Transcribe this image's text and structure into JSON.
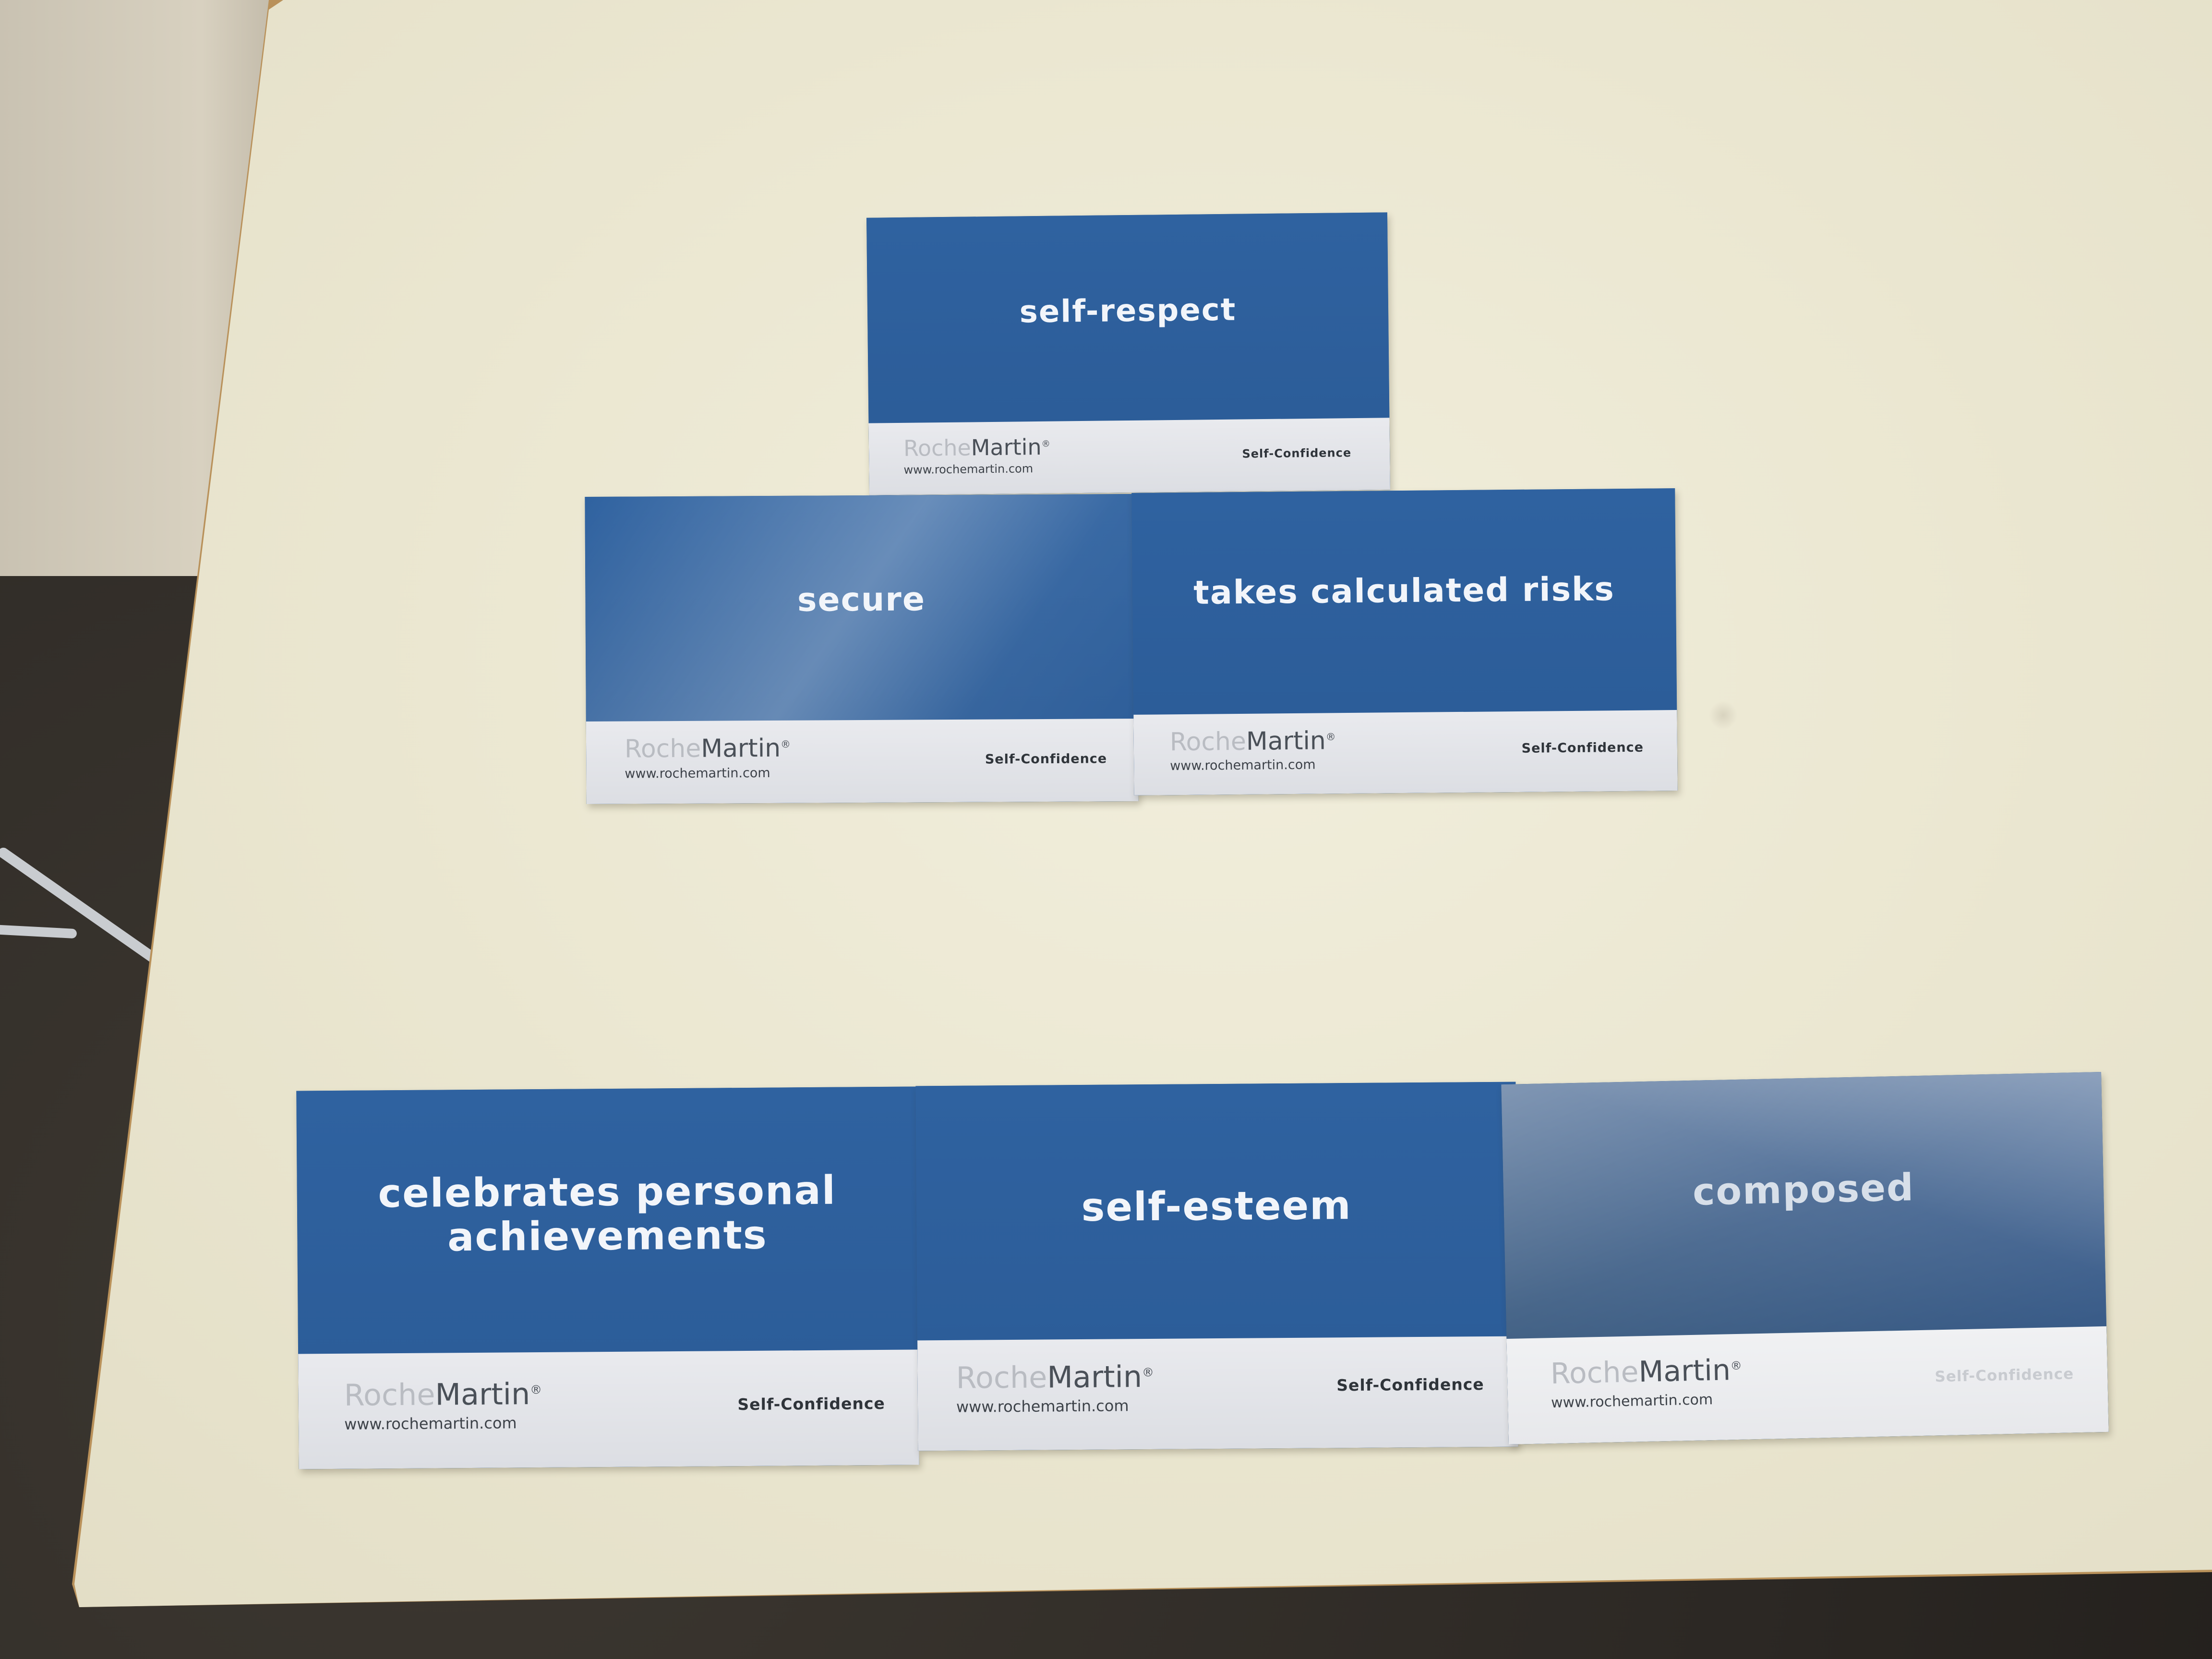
{
  "scene": {
    "brand": "RocheMartin",
    "brand_parts": {
      "roche": "Roche",
      "martin": "Martin"
    },
    "url": "www.rochemartin.com",
    "colors": {
      "card_blue": "#2d5f9c",
      "card_footer": "#e3e4e8",
      "table": "#ece8d3",
      "floor": "#2c2824"
    }
  },
  "cards": [
    {
      "word": "self-respect",
      "category": "Self-Confidence"
    },
    {
      "word": "secure",
      "category": "Self-Confidence"
    },
    {
      "word": "takes calculated risks",
      "category": "Self-Confidence"
    },
    {
      "word_line1": "celebrates personal",
      "word_line2": "achievements",
      "category": "Self-Confidence"
    },
    {
      "word": "self-esteem",
      "category": "Self-Confidence"
    },
    {
      "word": "composed",
      "category": "Self-Confidence"
    }
  ]
}
